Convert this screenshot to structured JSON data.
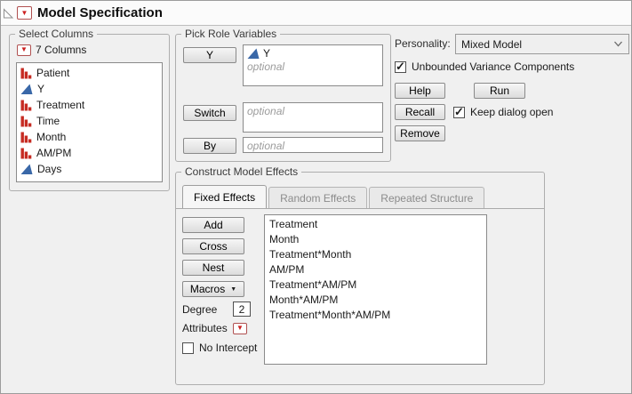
{
  "colors": {
    "accent_red": "#c62b22",
    "continuous_blue": "#3a68a8"
  },
  "title": {
    "label": "Model Specification"
  },
  "select_columns": {
    "legend": "Select Columns",
    "count_label": "7 Columns",
    "items": [
      {
        "name": "Patient",
        "type": "nominal"
      },
      {
        "name": "Y",
        "type": "continuous"
      },
      {
        "name": "Treatment",
        "type": "nominal"
      },
      {
        "name": "Time",
        "type": "nominal"
      },
      {
        "name": "Month",
        "type": "nominal"
      },
      {
        "name": "AM/PM",
        "type": "nominal"
      },
      {
        "name": "Days",
        "type": "continuous"
      }
    ]
  },
  "pick_roles": {
    "legend": "Pick Role Variables",
    "y": {
      "button": "Y",
      "assigned": "Y",
      "placeholder": "optional"
    },
    "switch": {
      "button": "Switch",
      "placeholder": "optional"
    },
    "by": {
      "button": "By",
      "placeholder": "optional"
    }
  },
  "personality": {
    "label": "Personality:",
    "value": "Mixed Model"
  },
  "options": {
    "unbounded": {
      "label": "Unbounded Variance Components",
      "checked": true
    },
    "keep_dialog_open": {
      "label": "Keep dialog open",
      "checked": true
    }
  },
  "actions": {
    "help": "Help",
    "run": "Run",
    "recall": "Recall",
    "remove": "Remove"
  },
  "model_effects": {
    "legend": "Construct Model Effects",
    "tabs": [
      "Fixed Effects",
      "Random Effects",
      "Repeated Structure"
    ],
    "active_tab": "Fixed Effects",
    "buttons": {
      "add": "Add",
      "cross": "Cross",
      "nest": "Nest",
      "macros": "Macros"
    },
    "degree": {
      "label": "Degree",
      "value": "2"
    },
    "attributes_label": "Attributes",
    "no_intercept": {
      "label": "No Intercept",
      "checked": false
    },
    "effects": [
      "Treatment",
      "Month",
      "Treatment*Month",
      "AM/PM",
      "Treatment*AM/PM",
      "Month*AM/PM",
      "Treatment*Month*AM/PM"
    ]
  }
}
